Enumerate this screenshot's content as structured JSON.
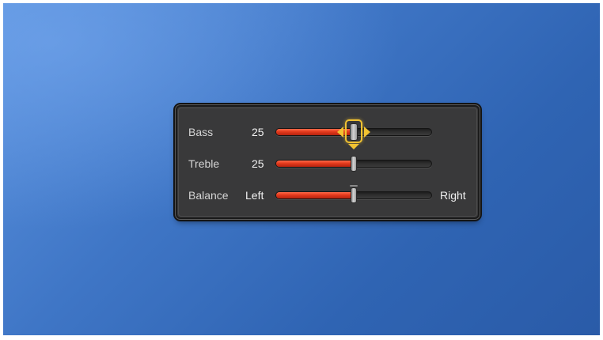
{
  "colors": {
    "accent_fill": "#e33a1c",
    "focus": "#f1c232",
    "panel": "#39393a",
    "background": "#3f76c6"
  },
  "sliders": [
    {
      "label": "Bass",
      "value_text": "25",
      "level": 0.5,
      "focused": true
    },
    {
      "label": "Treble",
      "value_text": "25",
      "level": 0.5,
      "focused": false
    },
    {
      "label": "Balance",
      "value_text": "Left",
      "end_text": "Right",
      "level": 0.5,
      "focused": false
    }
  ]
}
